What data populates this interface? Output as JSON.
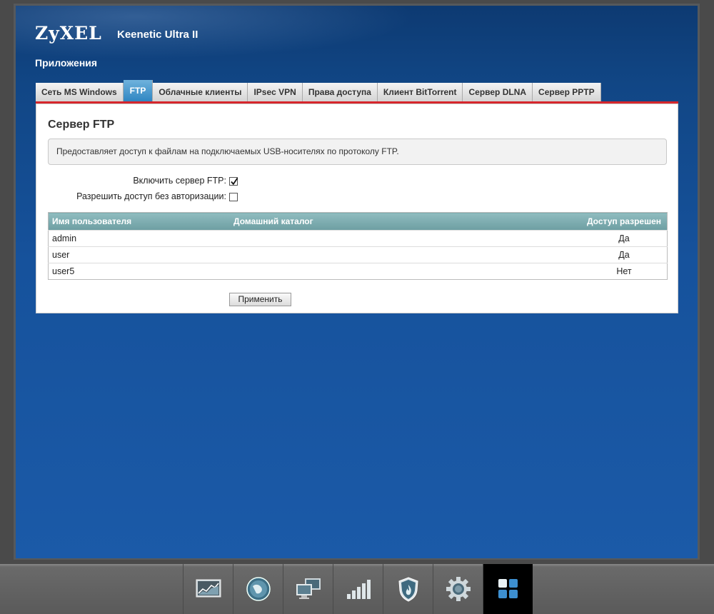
{
  "header": {
    "brand": "ZyXEL",
    "model": "Keenetic Ultra II",
    "section": "Приложения"
  },
  "tabs": [
    {
      "label": "Сеть MS Windows",
      "active": false
    },
    {
      "label": "FTP",
      "active": true
    },
    {
      "label": "Облачные клиенты",
      "active": false
    },
    {
      "label": "IPsec VPN",
      "active": false
    },
    {
      "label": "Права доступа",
      "active": false
    },
    {
      "label": "Клиент BitTorrent",
      "active": false
    },
    {
      "label": "Сервер DLNA",
      "active": false
    },
    {
      "label": "Сервер PPTP",
      "active": false
    }
  ],
  "panel": {
    "title": "Сервер FTP",
    "description": "Предоставляет доступ к файлам на подключаемых USB-носителях по протоколу FTP.",
    "enable_label": "Включить сервер FTP:",
    "enable_checked": true,
    "anon_label": "Разрешить доступ без авторизации:",
    "anon_checked": false,
    "table": {
      "headers": [
        "Имя пользователя",
        "Домашний каталог",
        "Доступ разрешен"
      ],
      "rows": [
        [
          "admin",
          "",
          "Да"
        ],
        [
          "user",
          "",
          "Да"
        ],
        [
          "user5",
          "",
          "Нет"
        ]
      ]
    },
    "apply_label": "Применить"
  },
  "nav": [
    {
      "name": "monitor-icon",
      "active": false
    },
    {
      "name": "internet-globe-icon",
      "active": false
    },
    {
      "name": "home-network-icon",
      "active": false
    },
    {
      "name": "wifi-signal-icon",
      "active": false
    },
    {
      "name": "security-shield-icon",
      "active": false
    },
    {
      "name": "system-gear-icon",
      "active": false
    },
    {
      "name": "applications-icon",
      "active": true
    }
  ],
  "colors": {
    "accent_red": "#d6262c",
    "active_tab": "#2f86c2",
    "background_blue": "#16529c"
  }
}
